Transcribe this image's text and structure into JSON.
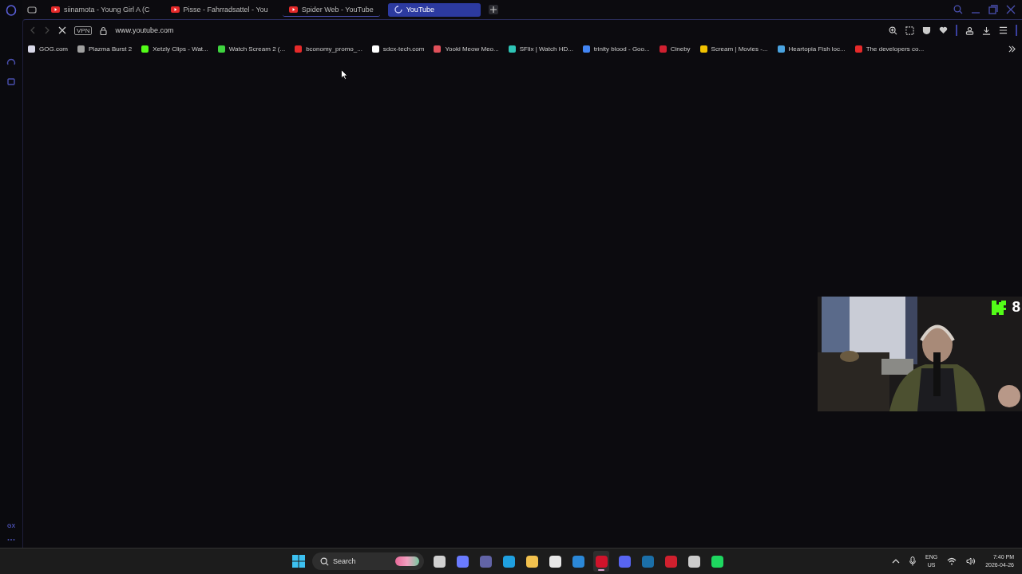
{
  "tabs": [
    {
      "title": "siinamota - Young Girl A (C",
      "selected": false,
      "kind": "youtube"
    },
    {
      "title": "Pisse - Fahrradsattel - You",
      "selected": false,
      "kind": "youtube"
    },
    {
      "title": "Spider Web - YouTube",
      "selected": false,
      "kind": "youtube"
    },
    {
      "title": "YouTube",
      "selected": true,
      "kind": "loading"
    }
  ],
  "address_bar": {
    "vpn_label": "VPN",
    "url": "www.youtube.com"
  },
  "bookmarks": [
    {
      "title": "GOG.com",
      "color": "#d8d8e8"
    },
    {
      "title": "Plazma Burst 2",
      "color": "#a0a0a0"
    },
    {
      "title": "Xetzly Clips - Wat...",
      "color": "#53fc18"
    },
    {
      "title": "Watch Scream 2 (...",
      "color": "#3fd43f"
    },
    {
      "title": "bconomy_promo_...",
      "color": "#e62a2a"
    },
    {
      "title": "sdcx-tech.com",
      "color": "#ffffff"
    },
    {
      "title": "Yooki Meow Meo...",
      "color": "#e0505a"
    },
    {
      "title": "SFlix | Watch HD...",
      "color": "#2ec4b6"
    },
    {
      "title": "trinity blood - Goo...",
      "color": "#4285f4"
    },
    {
      "title": "Cineby",
      "color": "#d02030"
    },
    {
      "title": "Scream | Movies -...",
      "color": "#f2c200"
    },
    {
      "title": "Heartopia Fish loc...",
      "color": "#4aa3df"
    },
    {
      "title": "The developers co...",
      "color": "#e62a2a"
    }
  ],
  "sidebar": {
    "gx_label": "GX"
  },
  "webcam": {
    "kind": "picture",
    "viewer_count": "8"
  },
  "taskbar": {
    "search_placeholder": "Search",
    "apps": [
      {
        "kind": "taskview",
        "active": false
      },
      {
        "kind": "copilot",
        "active": false
      },
      {
        "kind": "teams",
        "active": false
      },
      {
        "kind": "edge",
        "active": false
      },
      {
        "kind": "folder",
        "active": false
      },
      {
        "kind": "store",
        "active": false
      },
      {
        "kind": "mail",
        "active": false
      },
      {
        "kind": "opera",
        "active": true
      },
      {
        "kind": "discord",
        "active": false
      },
      {
        "kind": "steam",
        "active": false
      },
      {
        "kind": "flame",
        "active": false
      },
      {
        "kind": "obs",
        "active": false
      },
      {
        "kind": "spotify",
        "active": false
      }
    ],
    "language": "ENG",
    "region": "US",
    "time": "7:40 PM",
    "date": "2026-04-26"
  }
}
